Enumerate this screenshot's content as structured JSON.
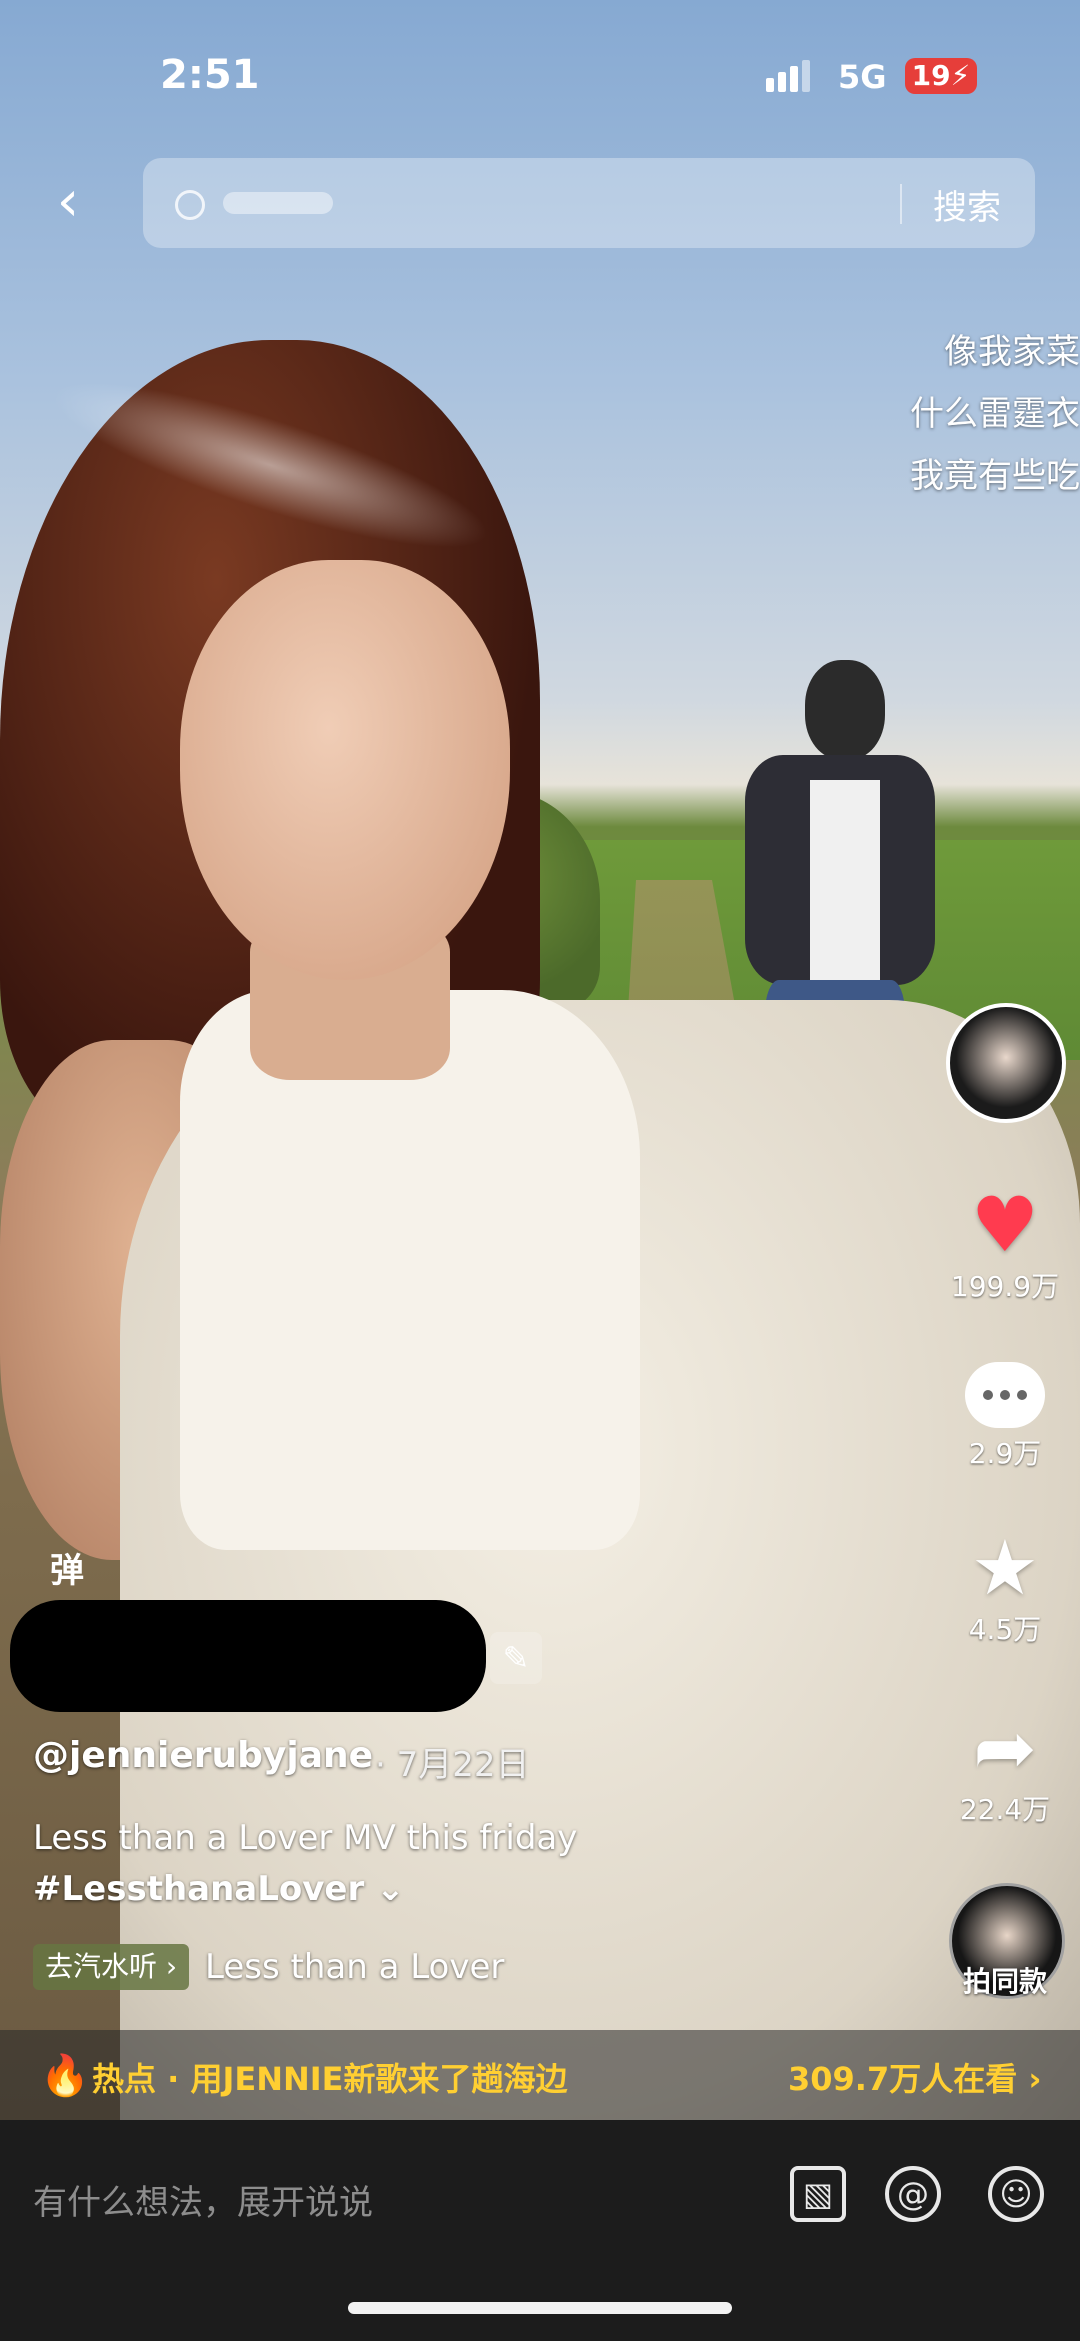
{
  "status": {
    "time": "2:51",
    "network": "5G",
    "battery": "19"
  },
  "topbar": {
    "back_icon": "chevron-left-icon",
    "search_button": "搜索"
  },
  "bullets": [
    "像我家菜",
    "什么雷霆衣",
    "我竟有些吃"
  ],
  "rail": {
    "likes": "199.9万",
    "comments": "2.9万",
    "favorites": "4.5万",
    "shares": "22.4万",
    "same_style": "拍同款",
    "like_color": "#ff3b4f"
  },
  "video": {
    "danmaku_toggle": "弹",
    "author": "@jennierubyjane",
    "date": "· 7月22日",
    "description": "Less than a Lover MV this friday",
    "hashtag": "#LessthanaLover",
    "music_link": "去汽水听",
    "song": "Less than a Lover"
  },
  "hot": {
    "text": "热点 · 用JENNIE新歌来了趟海边",
    "viewers": "309.7万人在看"
  },
  "composer": {
    "placeholder": "有什么想法，展开说说"
  }
}
